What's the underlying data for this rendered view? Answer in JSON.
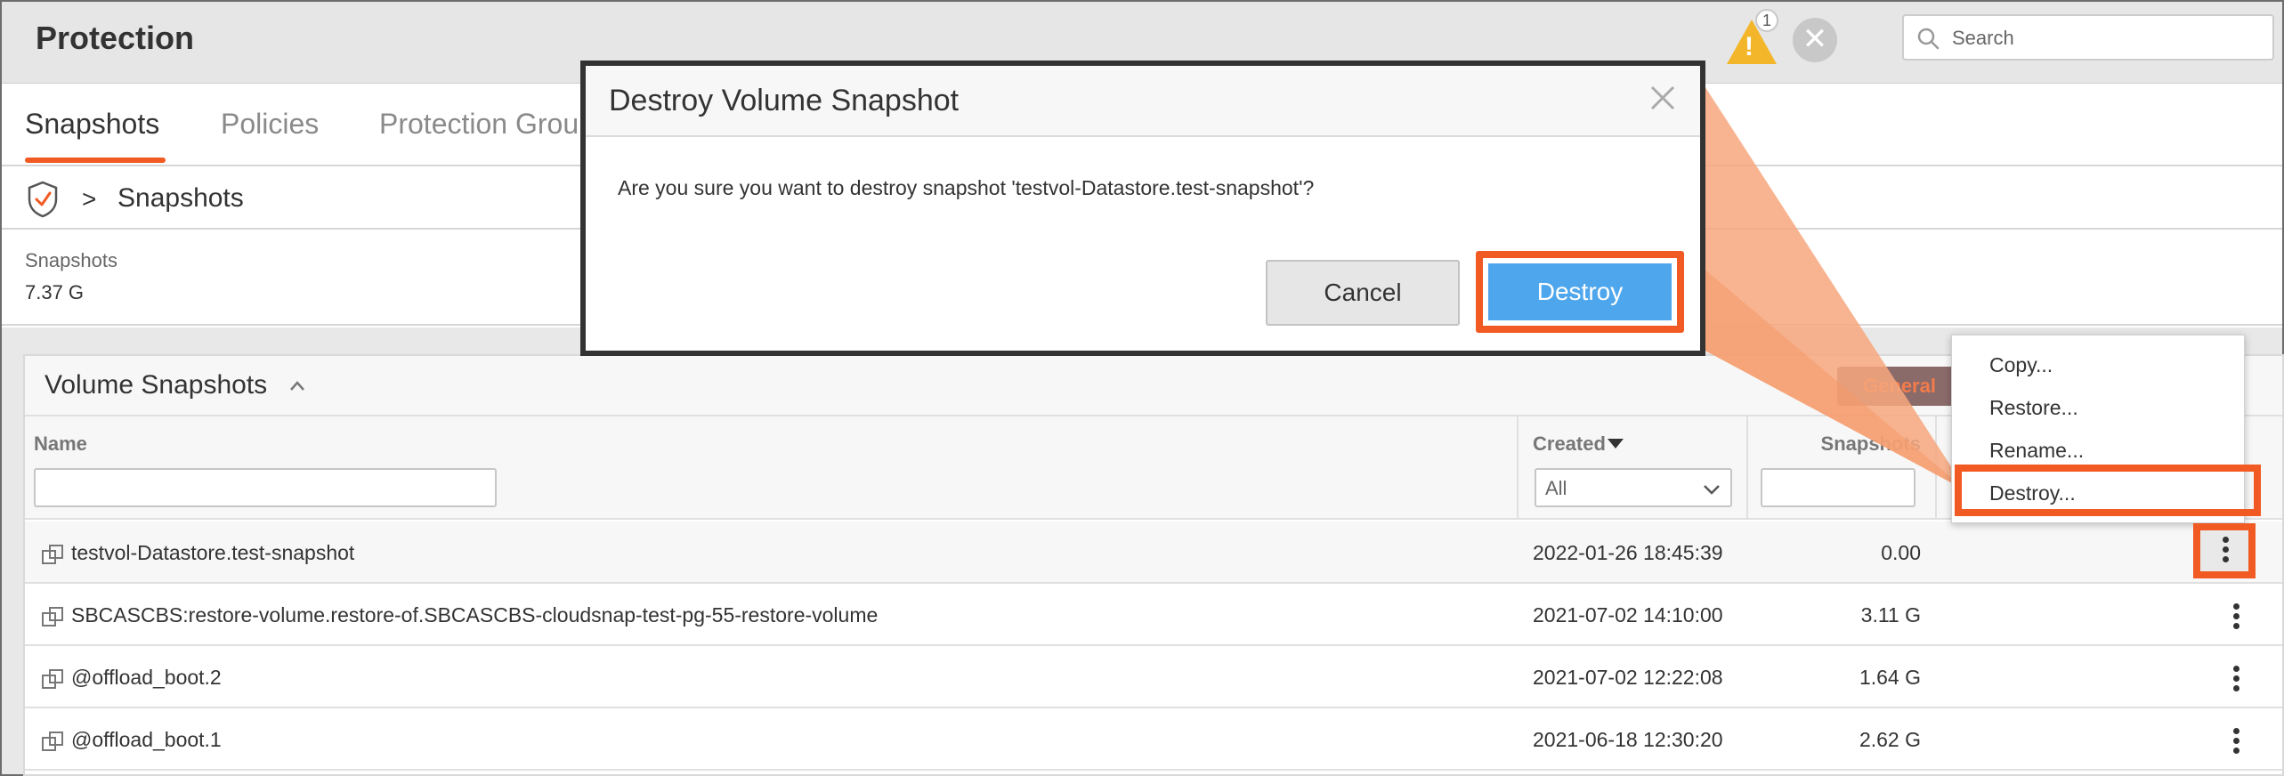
{
  "header": {
    "title": "Protection",
    "alert_count": "1",
    "alert_mark": "!",
    "dismiss_glyph": "✕",
    "search_placeholder": "Search"
  },
  "tabs": [
    {
      "label": "Snapshots",
      "active": true
    },
    {
      "label": "Policies"
    },
    {
      "label": "Protection Grou"
    }
  ],
  "breadcrumb": {
    "separator": ">",
    "label": "Snapshots"
  },
  "summary": {
    "label": "Snapshots",
    "value": "7.37 G"
  },
  "panel": {
    "title": "Volume Snapshots",
    "view_button": "General",
    "columns": {
      "name": "Name",
      "created": "Created",
      "snapshots": "Snapshots"
    },
    "created_filter": "All",
    "rows": [
      {
        "name": "testvol-Datastore.test-snapshot",
        "created": "2022-01-26 18:45:39",
        "size": "0.00"
      },
      {
        "name": "SBCASCBS:restore-volume.restore-of.SBCASCBS-cloudsnap-test-pg-55-restore-volume",
        "created": "2021-07-02 14:10:00",
        "size": "3.11 G"
      },
      {
        "name": "@offload_boot.2",
        "created": "2021-07-02 12:22:08",
        "size": "1.64 G"
      },
      {
        "name": "@offload_boot.1",
        "created": "2021-06-18 12:30:20",
        "size": "2.62 G"
      }
    ]
  },
  "context_menu": {
    "items": [
      "Copy...",
      "Restore...",
      "Rename...",
      "Destroy..."
    ]
  },
  "dialog": {
    "title": "Destroy Volume Snapshot",
    "message": "Are you sure you want to destroy snapshot 'testvol-Datastore.test-snapshot'?",
    "cancel_label": "Cancel",
    "destroy_label": "Destroy"
  },
  "colors": {
    "accent_orange": "#f15a22",
    "primary_blue": "#4ea6ec",
    "warning_yellow": "#f3b62a"
  }
}
